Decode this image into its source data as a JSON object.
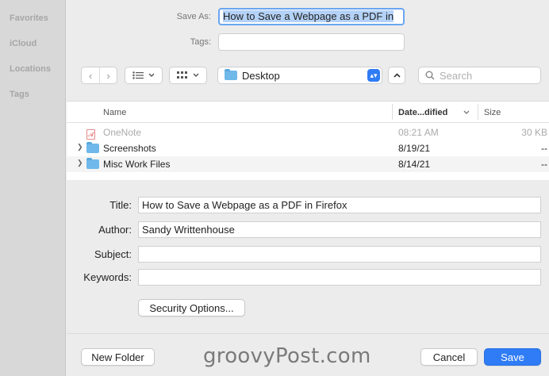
{
  "sidebar": {
    "items": [
      {
        "label": "Favorites"
      },
      {
        "label": "iCloud"
      },
      {
        "label": "Locations"
      },
      {
        "label": "Tags"
      }
    ]
  },
  "header": {
    "save_as_label": "Save As:",
    "save_as_value": "How to Save a Webpage as a PDF in",
    "tags_label": "Tags:"
  },
  "toolbar": {
    "back_icon": "chevron-left-icon",
    "forward_icon": "chevron-right-icon",
    "location": "Desktop",
    "search_placeholder": "Search"
  },
  "file_list": {
    "columns": [
      "Name",
      "Date...dified",
      "Size"
    ],
    "rows": [
      {
        "name": "OneNote",
        "date": "08:21 AM",
        "size": "30 KB",
        "type": "pdf",
        "disabled": true
      },
      {
        "name": "Screenshots",
        "date": "8/19/21",
        "size": "--",
        "type": "folder",
        "disabled": false
      },
      {
        "name": "Misc Work Files",
        "date": "8/14/21",
        "size": "--",
        "type": "folder",
        "disabled": false
      }
    ]
  },
  "metadata": {
    "title_label": "Title:",
    "title_value": "How to Save a Webpage as a PDF in Firefox",
    "author_label": "Author:",
    "author_value": "Sandy Writtenhouse",
    "subject_label": "Subject:",
    "subject_value": "",
    "keywords_label": "Keywords:",
    "keywords_value": "",
    "security_button": "Security Options..."
  },
  "footer": {
    "new_folder": "New Folder",
    "cancel": "Cancel",
    "save": "Save",
    "watermark": "groovyPost.com"
  },
  "colors": {
    "accent": "#2f7cf6",
    "selection": "#b4d2f7",
    "folder": "#6fb8ea"
  }
}
